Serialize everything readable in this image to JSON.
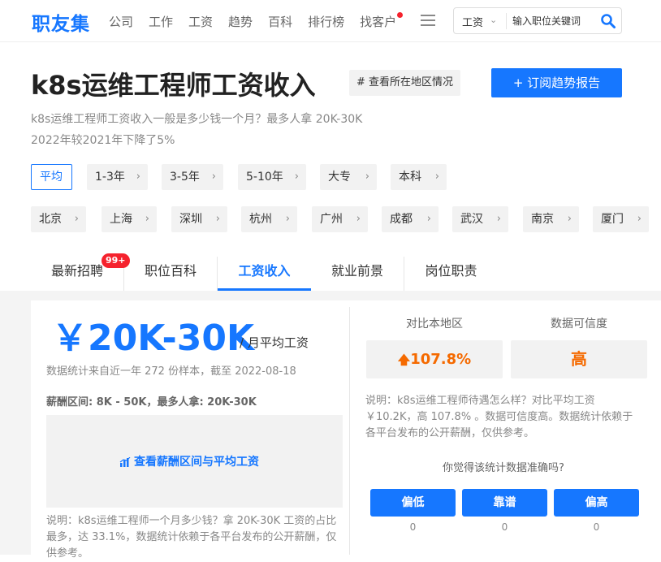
{
  "header": {
    "logo": "职友集",
    "nav": [
      "公司",
      "工作",
      "工资",
      "趋势",
      "百科",
      "排行榜",
      "找客户"
    ],
    "search_select": "工资",
    "search_placeholder": "输入职位关键词"
  },
  "title": "k8s运维工程师工资收入",
  "region_button": "# 查看所在地区情况",
  "subscribe_button": "+ 订阅趋势报告",
  "desc_line1": "k8s运维工程师工资收入一般是多少钱一个月？最多人拿 20K-30K",
  "desc_line2": "2022年较2021年下降了5%",
  "filters": {
    "row1": [
      "平均",
      "1-3年",
      "3-5年",
      "5-10年",
      "大专",
      "本科"
    ],
    "row2": [
      "北京",
      "上海",
      "深圳",
      "杭州",
      "广州",
      "成都",
      "武汉",
      "南京",
      "厦门"
    ]
  },
  "tabs": [
    "最新招聘",
    "职位百科",
    "工资收入",
    "就业前景",
    "岗位职责"
  ],
  "badge": "99+",
  "salary": {
    "amount": "￥20K-30K",
    "unit": "/ 月平均工资",
    "stat": "数据统计来自近一年 272 份样本，截至 2022-08-18",
    "range": "薪酬区间: 8K - 50K，最多人拿: 20K-30K",
    "view_link": "查看薪酬区间与平均工资",
    "note": "说明：k8s运维工程师一个月多少钱？拿 20K-30K 工资的占比最多，达 33.1%，数据统计依赖于各平台发布的公开薪酬，仅供参考。"
  },
  "compare": {
    "label": "对比本地区",
    "value": "107.8%",
    "credibility_label": "数据可信度",
    "credibility_value": "高",
    "note": "说明：k8s运维工程师待遇怎么样？对比平均工资 ￥10.2K，高 107.8% 。数据可信度高。数据统计依赖于各平台发布的公开薪酬，仅供参考。",
    "question": "你觉得该统计数据准确吗?",
    "votes": [
      {
        "label": "偏低",
        "count": "0"
      },
      {
        "label": "靠谱",
        "count": "0"
      },
      {
        "label": "偏高",
        "count": "0"
      }
    ]
  },
  "colors": {
    "accent": "#1677ff",
    "up": "#f56a00",
    "badge": "#f5222d"
  }
}
